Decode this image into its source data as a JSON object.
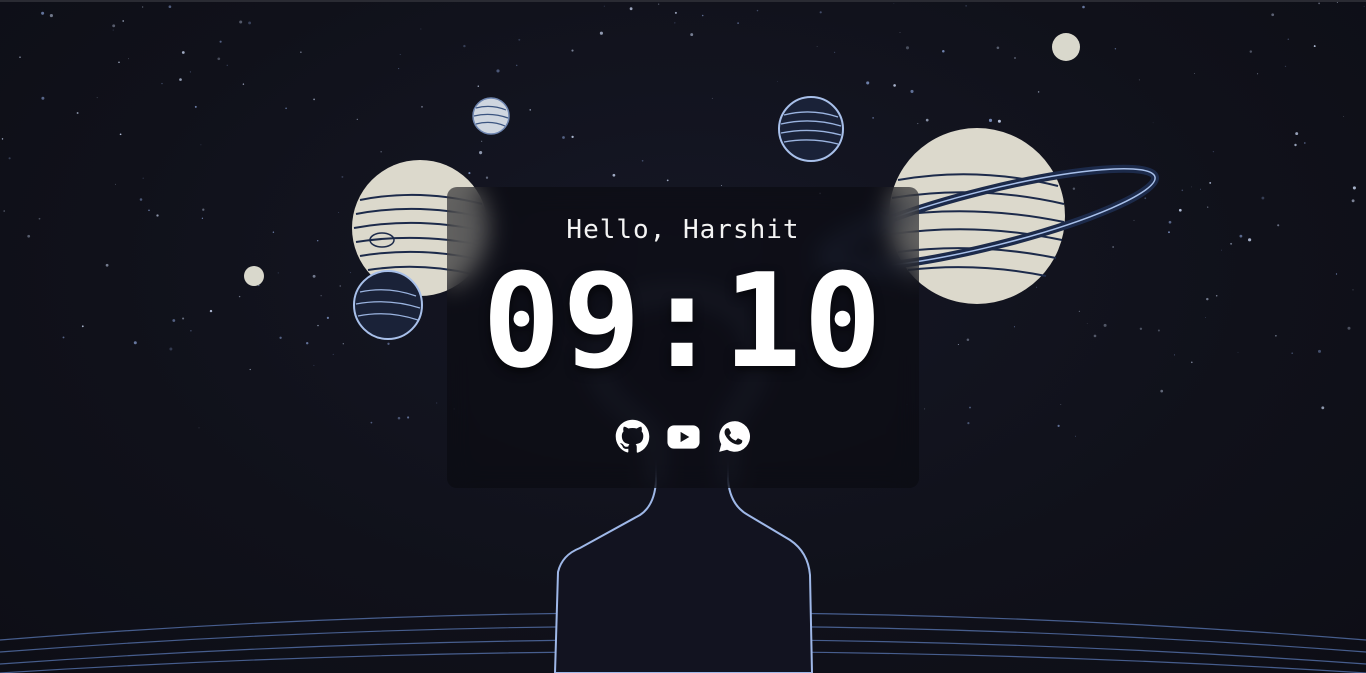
{
  "greeting": "Hello, Harshit",
  "clock": {
    "hours": "09",
    "separator": ":",
    "minutes": "10"
  },
  "socials": [
    {
      "icon": "github-icon",
      "label": "GitHub"
    },
    {
      "icon": "youtube-icon",
      "label": "YouTube"
    },
    {
      "icon": "whatsapp-icon",
      "label": "WhatsApp"
    }
  ],
  "colors": {
    "background": "#10111a",
    "planet_fill": "#dcd9cc",
    "planet_stroke": "#1c2a4a",
    "outline_glow": "#9fb8e8",
    "text": "#ffffff"
  }
}
